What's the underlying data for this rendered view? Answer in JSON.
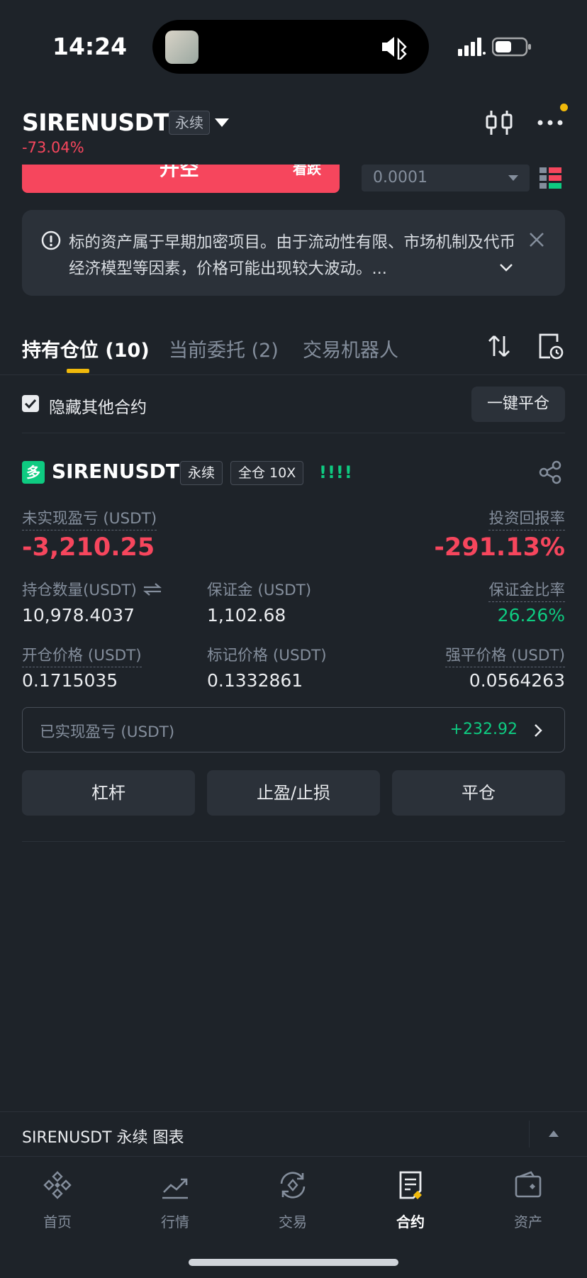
{
  "status": {
    "time": "14:24"
  },
  "header": {
    "symbol": "SIRENUSDT",
    "contract_type": "永续",
    "change": "-73.04%"
  },
  "trade_form": {
    "sell_label": "开空",
    "sell_sub": "看跌",
    "price_step": "0.0001"
  },
  "notice": {
    "text": "标的资产属于早期加密项目。由于流动性有限、市场机制及代币经济模型等因素，价格可能出现较大波动。..."
  },
  "tabs": [
    {
      "label": "持有仓位 (10)",
      "active": true
    },
    {
      "label": "当前委托 (2)",
      "active": false
    },
    {
      "label": "交易机器人",
      "active": false
    }
  ],
  "filter": {
    "hide_others_label": "隐藏其他合约",
    "hide_others_checked": true,
    "close_all_label": "一键平仓"
  },
  "position": {
    "side": "多",
    "symbol": "SIRENUSDT",
    "contract_type": "永续",
    "margin_mode": "全仓 10X",
    "bars": "!!!!",
    "unrealized_pnl_label": "未实现盈亏 (USDT)",
    "unrealized_pnl": "-3,210.25",
    "roi_label": "投资回报率",
    "roi": "-291.13%",
    "size_label": "持仓数量(USDT)",
    "size": "10,978.4037",
    "margin_label": "保证金 (USDT)",
    "margin": "1,102.68",
    "margin_ratio_label": "保证金比率",
    "margin_ratio": "26.26%",
    "entry_label": "开仓价格 (USDT)",
    "entry": "0.1715035",
    "mark_label": "标记价格 (USDT)",
    "mark": "0.1332861",
    "liq_label": "强平价格 (USDT)",
    "liq": "0.0564263",
    "realized_label": "已实现盈亏 (USDT)",
    "realized": "+232.92",
    "actions": [
      "杠杆",
      "止盈/止损",
      "平仓"
    ]
  },
  "chart_bar": {
    "label": "SIRENUSDT 永续 图表"
  },
  "nav": [
    {
      "label": "首页",
      "icon": "home-icon"
    },
    {
      "label": "行情",
      "icon": "markets-icon"
    },
    {
      "label": "交易",
      "icon": "trade-icon"
    },
    {
      "label": "合约",
      "icon": "futures-icon",
      "active": true
    },
    {
      "label": "资产",
      "icon": "wallet-icon"
    }
  ],
  "colors": {
    "bg": "#1e2329",
    "red": "#f6465d",
    "green": "#0ecb81",
    "yellow": "#f0b90b"
  }
}
